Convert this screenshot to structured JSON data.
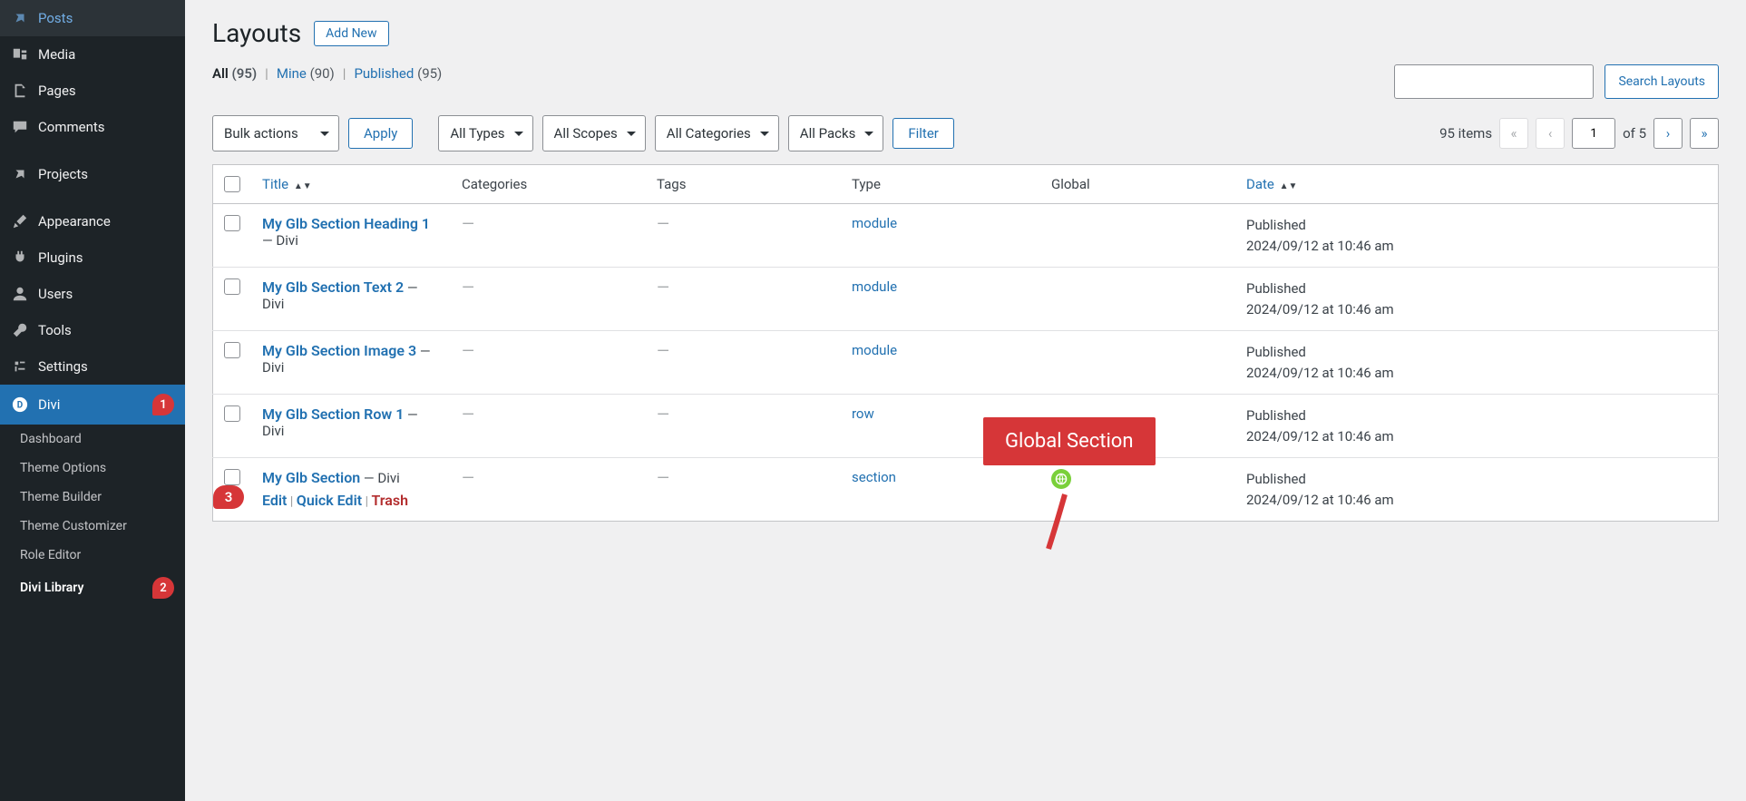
{
  "sidebar": {
    "items": [
      {
        "icon": "pin",
        "label": "Posts"
      },
      {
        "icon": "media",
        "label": "Media"
      },
      {
        "icon": "page",
        "label": "Pages"
      },
      {
        "icon": "comment",
        "label": "Comments"
      },
      {
        "icon": "pin",
        "label": "Projects"
      },
      {
        "icon": "brush",
        "label": "Appearance"
      },
      {
        "icon": "plug",
        "label": "Plugins"
      },
      {
        "icon": "user",
        "label": "Users"
      },
      {
        "icon": "wrench",
        "label": "Tools"
      },
      {
        "icon": "settings",
        "label": "Settings"
      },
      {
        "icon": "divi",
        "label": "Divi",
        "badge": "1",
        "active": true
      }
    ],
    "submenu": [
      {
        "label": "Dashboard"
      },
      {
        "label": "Theme Options"
      },
      {
        "label": "Theme Builder"
      },
      {
        "label": "Theme Customizer"
      },
      {
        "label": "Role Editor"
      },
      {
        "label": "Divi Library",
        "badge": "2",
        "active": true
      }
    ]
  },
  "page": {
    "title": "Layouts",
    "add_new": "Add New"
  },
  "filters": {
    "all_label": "All",
    "all_count": "(95)",
    "mine_label": "Mine",
    "mine_count": "(90)",
    "published_label": "Published",
    "published_count": "(95)"
  },
  "search": {
    "button": "Search Layouts"
  },
  "toolbar": {
    "bulk": "Bulk actions",
    "apply": "Apply",
    "types": "All Types",
    "scopes": "All Scopes",
    "categories": "All Categories",
    "packs": "All Packs",
    "filter": "Filter"
  },
  "pagination": {
    "items_text": "95 items",
    "current": "1",
    "of_text": "of 5"
  },
  "columns": {
    "title": "Title",
    "categories": "Categories",
    "tags": "Tags",
    "type": "Type",
    "global": "Global",
    "date": "Date"
  },
  "rows": [
    {
      "title": "My Glb Section Heading 1",
      "suffix": " — Divi",
      "type": "module",
      "date_status": "Published",
      "date_line": "2024/09/12 at 10:46 am"
    },
    {
      "title": "My Glb Section Text 2",
      "suffix": " — Divi",
      "type": "module",
      "date_status": "Published",
      "date_line": "2024/09/12 at 10:46 am"
    },
    {
      "title": "My Glb Section Image 3",
      "suffix": " — Divi",
      "type": "module",
      "date_status": "Published",
      "date_line": "2024/09/12 at 10:46 am"
    },
    {
      "title": "My Glb Section Row 1",
      "suffix": " — Divi",
      "type": "row",
      "date_status": "Published",
      "date_line": "2024/09/12 at 10:46 am"
    },
    {
      "title": "My Glb Section",
      "suffix": " — Divi",
      "type": "section",
      "global": true,
      "date_status": "Published",
      "date_line": "2024/09/12 at 10:46 am",
      "actions": true
    }
  ],
  "row_actions": {
    "edit": "Edit",
    "quick_edit": "Quick Edit",
    "trash": "Trash",
    "badge": "3"
  },
  "callout": {
    "text": "Global Section"
  }
}
